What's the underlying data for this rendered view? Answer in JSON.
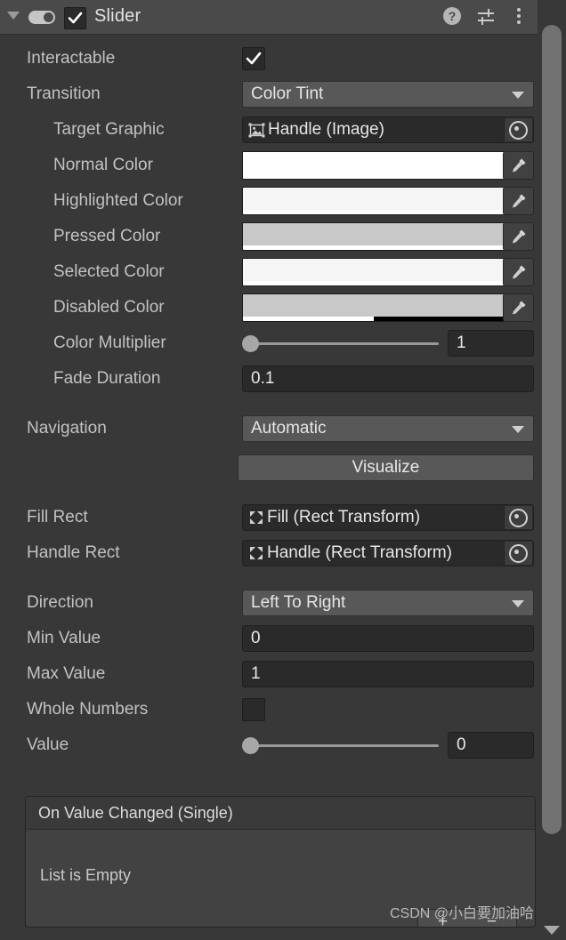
{
  "header": {
    "title": "Slider",
    "enabled_checkbox": true,
    "foldout_expanded": true,
    "icons": {
      "help": "?",
      "preset": "preset-icon",
      "menu": "kebab-menu-icon"
    }
  },
  "fields": {
    "interactable": {
      "label": "Interactable",
      "checked": true
    },
    "transition": {
      "label": "Transition",
      "value": "Color Tint"
    },
    "target_graphic": {
      "label": "Target Graphic",
      "value": "Handle (Image)"
    },
    "normal_color": {
      "label": "Normal Color",
      "hex": "#FFFFFF",
      "alpha_pct": 100
    },
    "highlighted_color": {
      "label": "Highlighted Color",
      "hex": "#F5F5F5",
      "alpha_pct": 100
    },
    "pressed_color": {
      "label": "Pressed Color",
      "hex": "#C8C8C8",
      "alpha_pct": 100
    },
    "selected_color": {
      "label": "Selected Color",
      "hex": "#F5F5F5",
      "alpha_pct": 100
    },
    "disabled_color": {
      "label": "Disabled Color",
      "hex": "#C8C8C8",
      "alpha_pct": 50
    },
    "color_multiplier": {
      "label": "Color Multiplier",
      "value": "1",
      "slider_pct": 0
    },
    "fade_duration": {
      "label": "Fade Duration",
      "value": "0.1"
    },
    "navigation": {
      "label": "Navigation",
      "value": "Automatic"
    },
    "visualize": {
      "label": "Visualize"
    },
    "fill_rect": {
      "label": "Fill Rect",
      "value": "Fill (Rect Transform)"
    },
    "handle_rect": {
      "label": "Handle Rect",
      "value": "Handle (Rect Transform)"
    },
    "direction": {
      "label": "Direction",
      "value": "Left To Right"
    },
    "min_value": {
      "label": "Min Value",
      "value": "0"
    },
    "max_value": {
      "label": "Max Value",
      "value": "1"
    },
    "whole_numbers": {
      "label": "Whole Numbers",
      "checked": false
    },
    "value": {
      "label": "Value",
      "value": "0",
      "slider_pct": 0
    }
  },
  "event_list": {
    "title": "On Value Changed (Single)",
    "empty_text": "List is Empty",
    "add_label": "+",
    "remove_label": "−"
  },
  "watermark": "CSDN @小白要加油哈",
  "colors": {
    "panel_bg": "#383838",
    "header_bg": "#4a4a4a",
    "field_bg": "#2a2a2a",
    "popup_bg": "#585858",
    "label": "#c2c2c2"
  }
}
